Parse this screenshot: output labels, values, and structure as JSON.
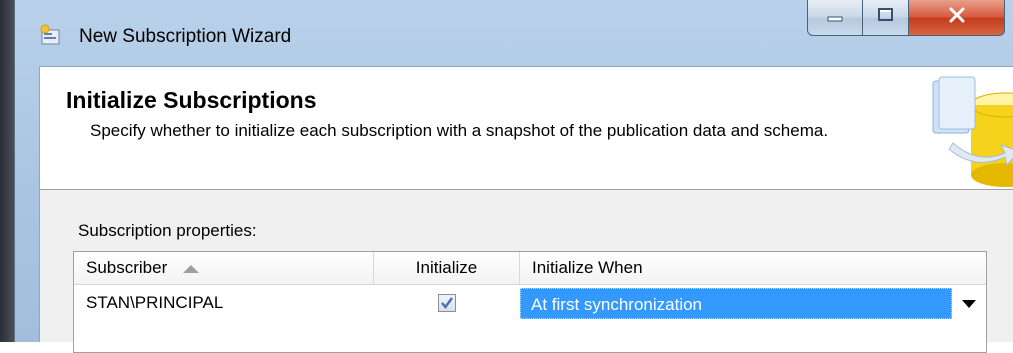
{
  "window": {
    "title": "New Subscription Wizard",
    "icon": "wizard-app-icon",
    "buttons": {
      "minimize": "minimize-icon",
      "maximize": "maximize-icon",
      "close": "close-icon"
    }
  },
  "header": {
    "title": "Initialize Subscriptions",
    "description": "Specify whether to initialize each subscription with a snapshot of the publication data and schema."
  },
  "properties": {
    "label": "Subscription properties:",
    "columns": [
      "Subscriber",
      "Initialize",
      "Initialize When"
    ],
    "sort_column": "Subscriber",
    "sort_direction": "ascending",
    "rows": [
      {
        "subscriber": "STAN\\PRINCIPAL",
        "initialize": true,
        "initialize_when": "At first synchronization"
      }
    ]
  },
  "colors": {
    "selection": "#3399ff",
    "close_button": "#c23a1e",
    "frame": "#b9d1ea"
  }
}
